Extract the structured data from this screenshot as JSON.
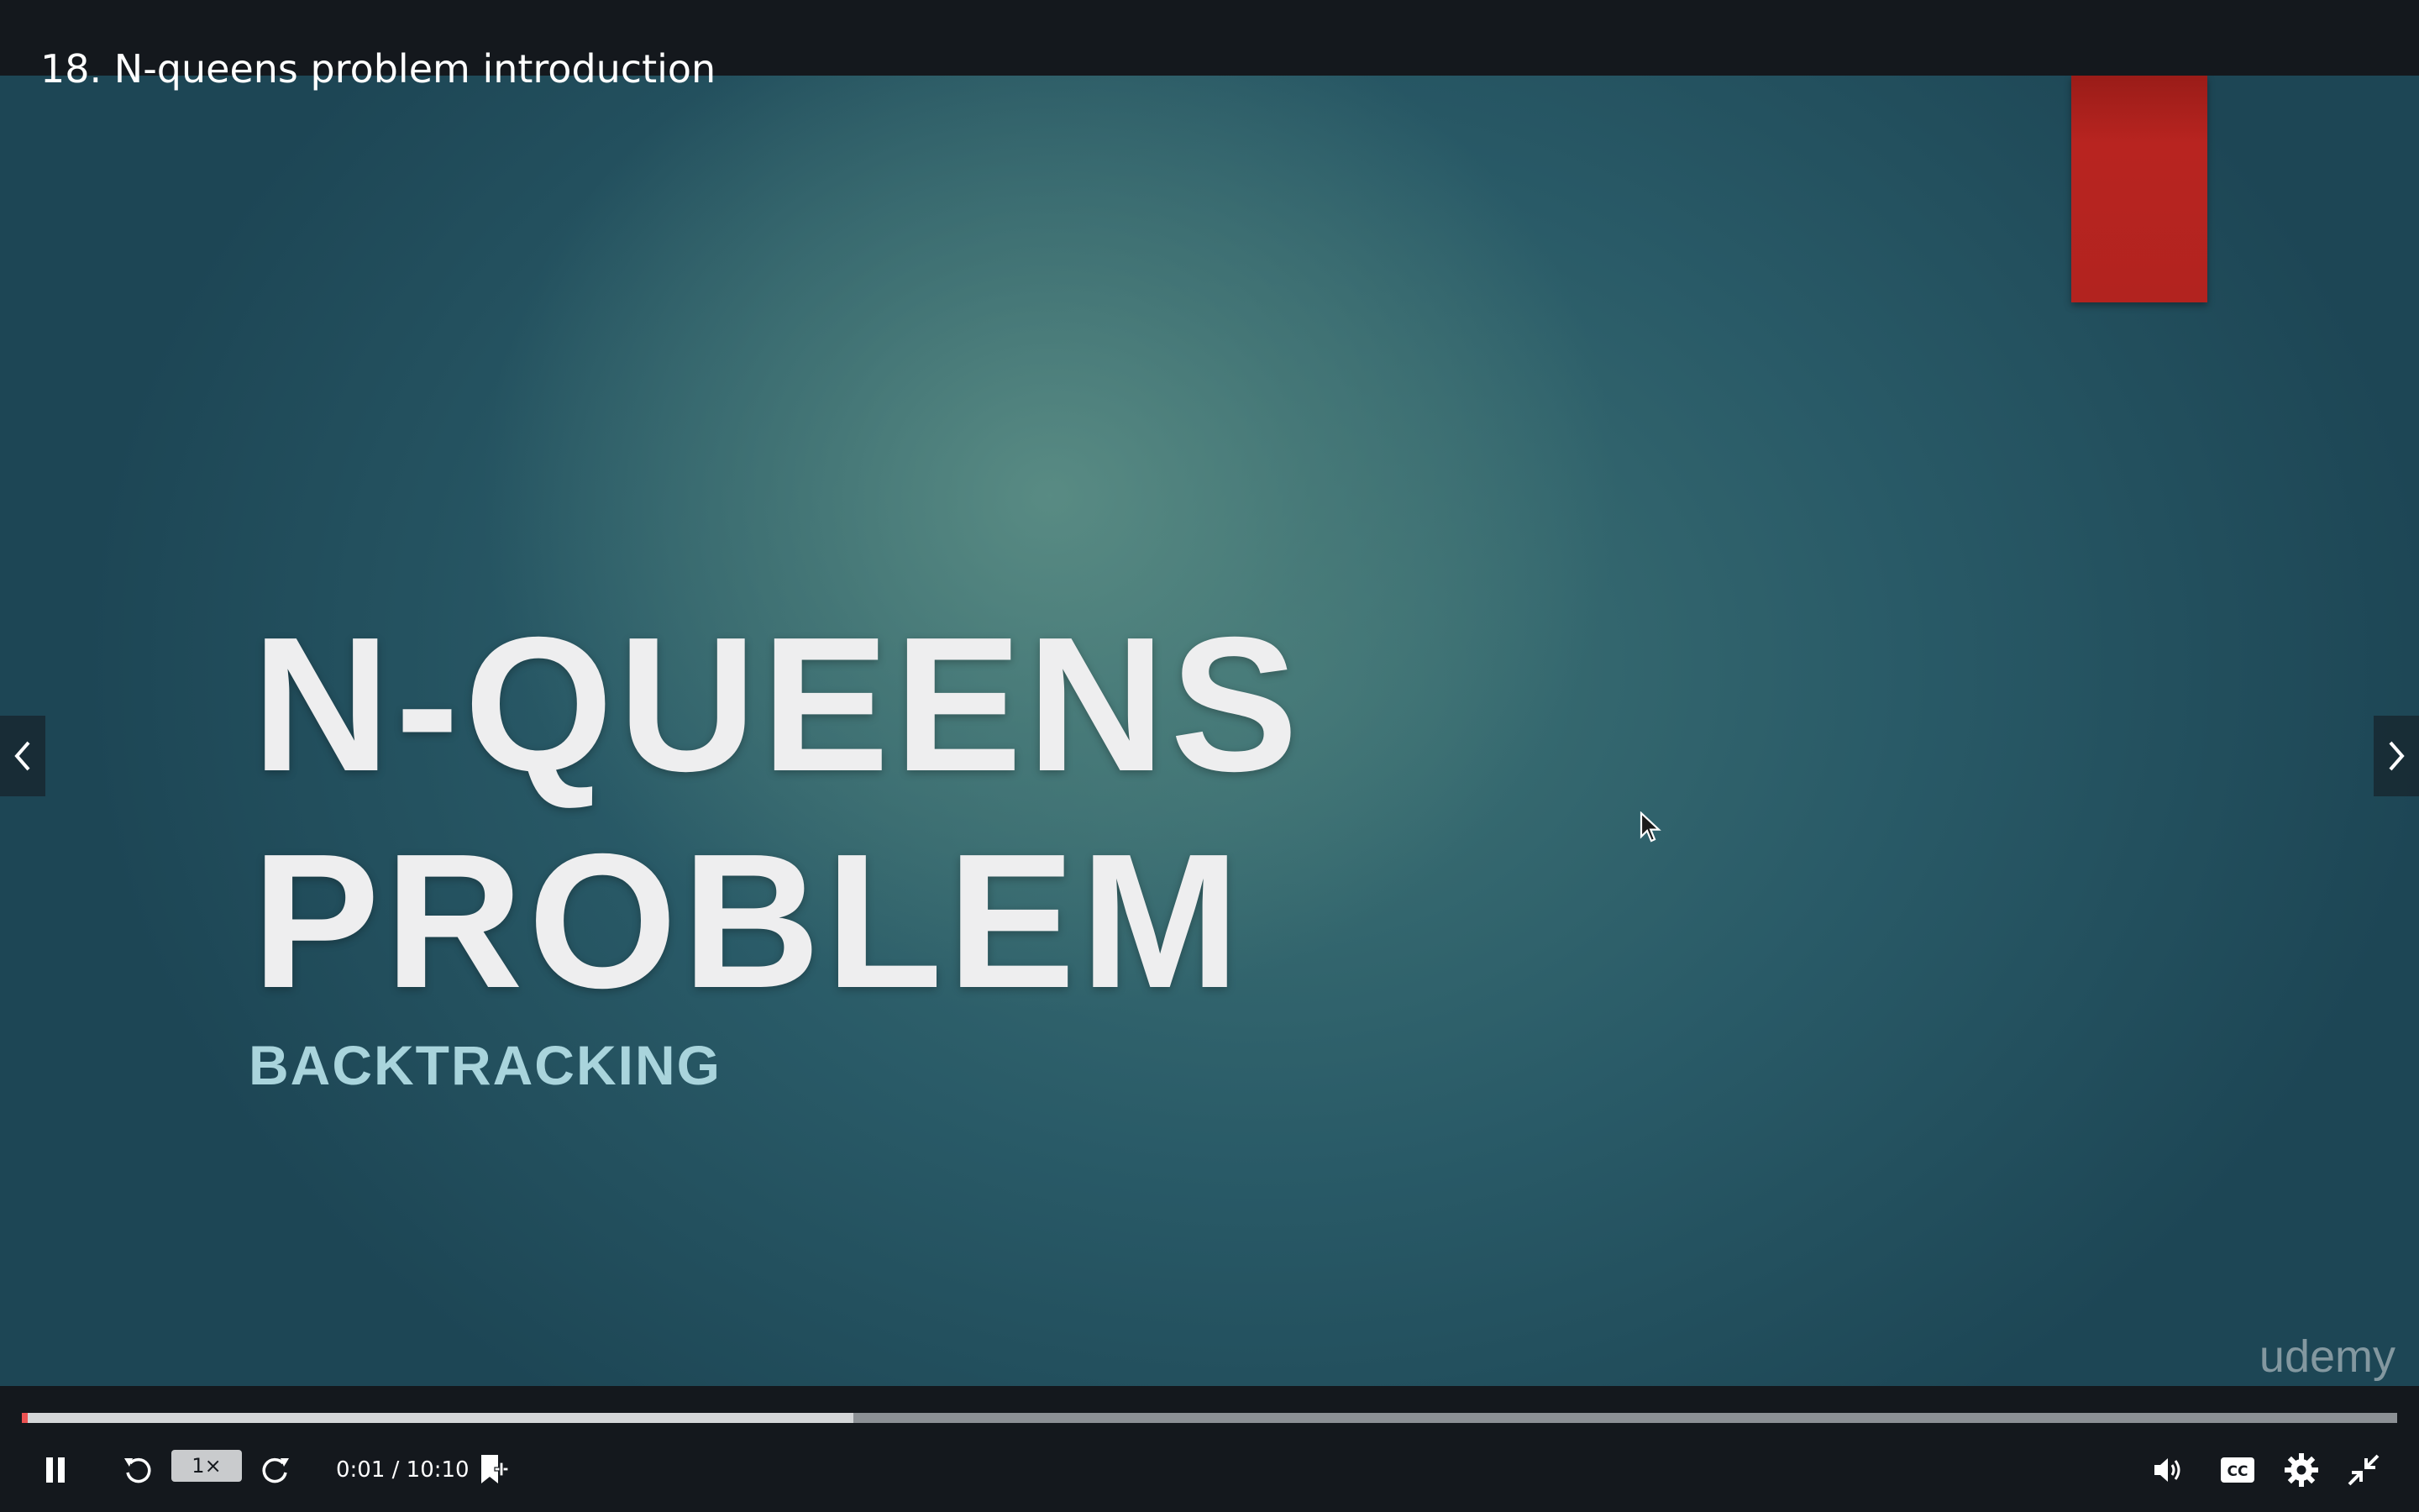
{
  "lecture": {
    "title": "18. N-queens problem introduction"
  },
  "slide": {
    "title": "N-QUEENS\nPROBLEM",
    "subtitle": "BACKTRACKING",
    "watermark": "udemy",
    "accent_color": "#b2231f"
  },
  "navigation": {
    "prev_icon": "chevron-left-icon",
    "next_icon": "chevron-right-icon"
  },
  "player": {
    "played_fraction": 0.001,
    "buffered_fraction": 0.35,
    "progress_color": "#ec5252",
    "speed_label": "1×",
    "time_display": "0:01 / 10:10",
    "icons": {
      "play_pause": "pause-icon",
      "rewind": "rewind-5s-icon",
      "forward": "forward-5s-icon",
      "bookmark": "add-bookmark-icon",
      "volume": "volume-icon",
      "captions": "captions-icon",
      "settings": "gear-icon",
      "fullscreen": "exit-fullscreen-icon"
    }
  }
}
